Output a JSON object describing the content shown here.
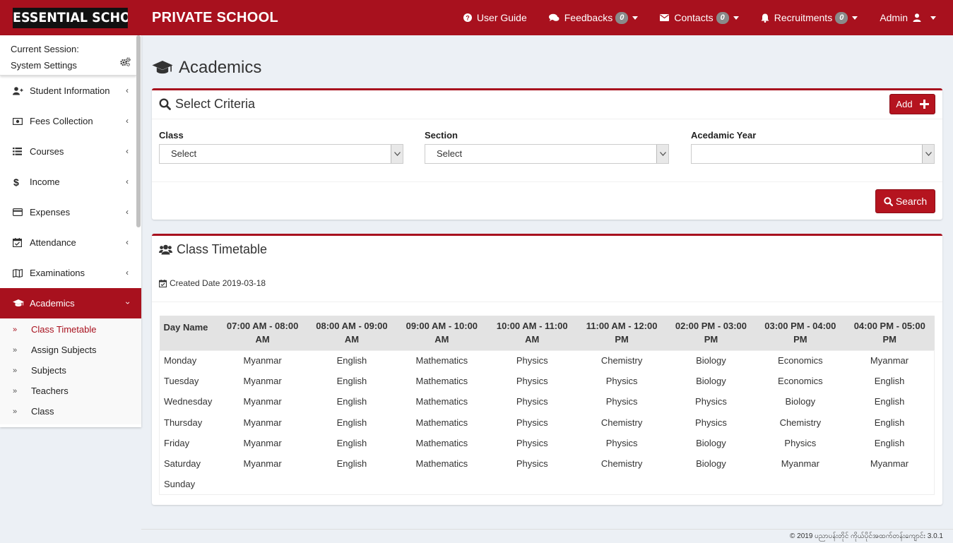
{
  "header": {
    "logo_text": "ESSENTIAL SCHOOL",
    "app_title": "PRIVATE SCHOOL",
    "brand_color": "#a8111e",
    "nav": {
      "user_guide": "User Guide",
      "feedbacks": "Feedbacks",
      "feedbacks_count": "0",
      "contacts": "Contacts",
      "contacts_count": "0",
      "recruitments": "Recruitments",
      "recruitments_count": "0",
      "admin": "Admin"
    }
  },
  "sidebar": {
    "session_line1": "Current Session:",
    "session_line2": "System Settings",
    "items": [
      {
        "label": "Student Information",
        "icon": "user-plus-icon"
      },
      {
        "label": "Fees Collection",
        "icon": "money-icon"
      },
      {
        "label": "Courses",
        "icon": "list-icon"
      },
      {
        "label": "Income",
        "icon": "dollar-icon"
      },
      {
        "label": "Expenses",
        "icon": "credit-card-icon"
      },
      {
        "label": "Attendance",
        "icon": "calendar-check-icon"
      },
      {
        "label": "Examinations",
        "icon": "map-icon"
      },
      {
        "label": "Academics",
        "icon": "graduation-cap-icon"
      }
    ],
    "sub_items": [
      "Class Timetable",
      "Assign Subjects",
      "Subjects",
      "Teachers",
      "Class"
    ]
  },
  "page": {
    "title": "Academics",
    "criteria": {
      "title": "Select Criteria",
      "add_label": "Add",
      "class_label": "Class",
      "class_value": "Select",
      "section_label": "Section",
      "section_value": "Select",
      "year_label": "Acedamic Year",
      "year_value": "",
      "search_label": "Search"
    },
    "timetable": {
      "title": "Class Timetable",
      "created": "Created Date 2019-03-18",
      "headers": [
        "Day Name",
        "07:00 AM - 08:00 AM",
        "08:00 AM - 09:00 AM",
        "09:00 AM - 10:00 AM",
        "10:00 AM - 11:00 AM",
        "11:00 AM - 12:00 PM",
        "02:00 PM - 03:00 PM",
        "03:00 PM - 04:00 PM",
        "04:00 PM - 05:00 PM"
      ],
      "rows": [
        [
          "Monday",
          "Myanmar",
          "English",
          "Mathematics",
          "Physics",
          "Chemistry",
          "Biology",
          "Economics",
          "Myanmar"
        ],
        [
          "Tuesday",
          "Myanmar",
          "English",
          "Mathematics",
          "Physics",
          "Physics",
          "Biology",
          "Economics",
          "English"
        ],
        [
          "Wednesday",
          "Myanmar",
          "English",
          "Mathematics",
          "Physics",
          "Physics",
          "Physics",
          "Biology",
          "English"
        ],
        [
          "Thursday",
          "Myanmar",
          "English",
          "Mathematics",
          "Physics",
          "Chemistry",
          "Physics",
          "Chemistry",
          "English"
        ],
        [
          "Friday",
          "Myanmar",
          "English",
          "Mathematics",
          "Physics",
          "Physics",
          "Biology",
          "Physics",
          "English"
        ],
        [
          "Saturday",
          "Myanmar",
          "English",
          "Mathematics",
          "Physics",
          "Chemistry",
          "Biology",
          "Myanmar",
          "Myanmar"
        ],
        [
          "Sunday",
          "",
          "",
          "",
          "",
          "",
          "",
          "",
          ""
        ]
      ]
    }
  },
  "footer": {
    "text": "© 2019 ပညာပန်းတိုင် ကိုယ်ပိုင်အထက်တန်းကျောင်း 3.0.1"
  }
}
